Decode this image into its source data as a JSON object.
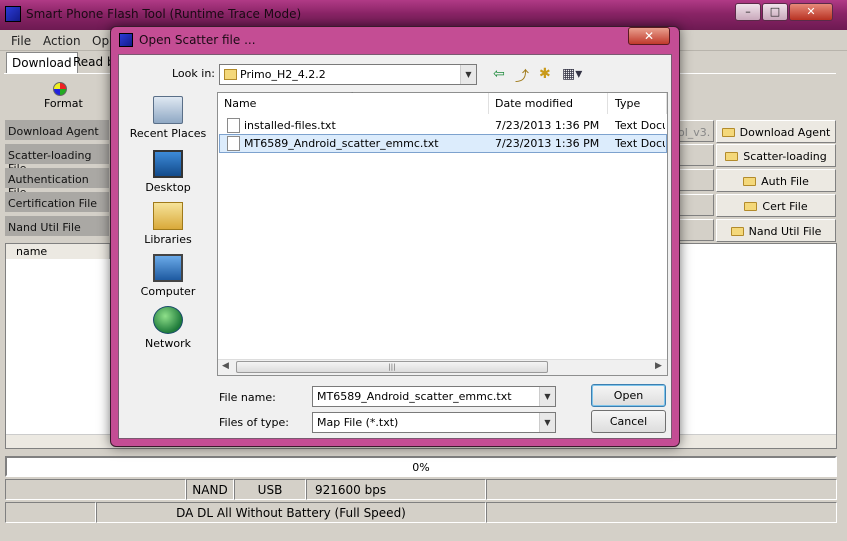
{
  "main": {
    "title": "Smart Phone Flash Tool (Runtime Trace Mode)",
    "window_controls": [
      "–",
      "□",
      "✕"
    ],
    "menu": [
      "File",
      "Action",
      "Op"
    ],
    "tabs": [
      "Download",
      "Read ba"
    ],
    "toolbar": {
      "format_label": "Format"
    },
    "left_labels": [
      "Download Agent",
      "Scatter-loading File",
      "Authentication File",
      "Certification File",
      "Nand Util File"
    ],
    "right_paths": [
      "ol_v3.",
      "",
      "",
      "",
      ""
    ],
    "right_buttons": [
      "Download Agent",
      "Scatter-loading",
      "Auth File",
      "Cert File",
      "Nand Util File"
    ],
    "list_header": "name",
    "progress": "0%",
    "status_row1": [
      "",
      "NAND",
      "USB",
      "921600 bps",
      ""
    ],
    "status_row2": [
      "",
      "DA DL All Without Battery (Full Speed)",
      ""
    ]
  },
  "dialog": {
    "title": "Open Scatter file ...",
    "close_label": "✕",
    "look_in_label": "Look in:",
    "look_in_value": "Primo_H2_4.2.2",
    "toolbar_icons": [
      "back-icon",
      "up-folder-icon",
      "new-folder-icon",
      "view-menu-icon"
    ],
    "places": [
      "Recent Places",
      "Desktop",
      "Libraries",
      "Computer",
      "Network"
    ],
    "columns": [
      "Name",
      "Date modified",
      "Type"
    ],
    "files": [
      {
        "name": "installed-files.txt",
        "date": "7/23/2013 1:36 PM",
        "type": "Text Docu"
      },
      {
        "name": "MT6589_Android_scatter_emmc.txt",
        "date": "7/23/2013 1:36 PM",
        "type": "Text Docu"
      }
    ],
    "file_name_label": "File name:",
    "file_name_value": "MT6589_Android_scatter_emmc.txt",
    "file_type_label": "Files of type:",
    "file_type_value": "Map File (*.txt)",
    "open_label": "Open",
    "cancel_label": "Cancel"
  }
}
